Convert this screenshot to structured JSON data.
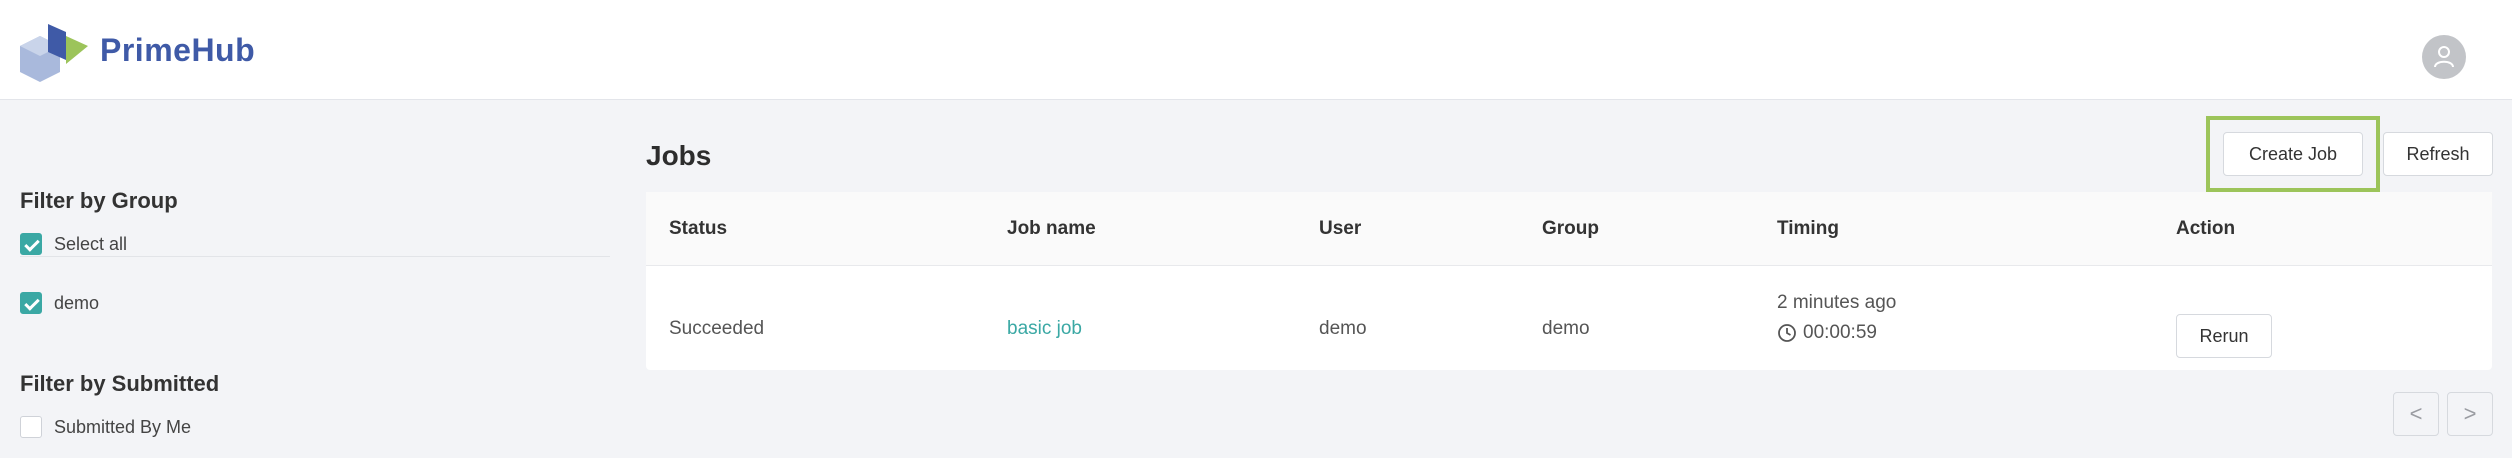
{
  "app": {
    "brand_part1": "Prime",
    "brand_part2": "Hub"
  },
  "sidebar": {
    "group_filter": {
      "title": "Filter by Group",
      "options": [
        {
          "label": "Select all",
          "checked": true
        },
        {
          "label": "demo",
          "checked": true
        }
      ]
    },
    "submitted_filter": {
      "title": "Filter by Submitted",
      "options": [
        {
          "label": "Submitted By Me",
          "checked": false
        }
      ]
    }
  },
  "main": {
    "title": "Jobs",
    "create_label": "Create Job",
    "refresh_label": "Refresh",
    "table": {
      "columns": [
        "Status",
        "Job name",
        "User",
        "Group",
        "Timing",
        "Action"
      ],
      "rows": [
        {
          "status": "Succeeded",
          "job_name": "basic job",
          "user": "demo",
          "group": "demo",
          "timing_relative": "2 minutes ago",
          "duration": "00:00:59",
          "action": "Rerun"
        }
      ]
    },
    "pagination": {
      "prev": "<",
      "next": ">"
    }
  },
  "colors": {
    "accent": "#3aa8a4",
    "brand": "#3f5aa7",
    "highlight": "#9cc45a"
  }
}
